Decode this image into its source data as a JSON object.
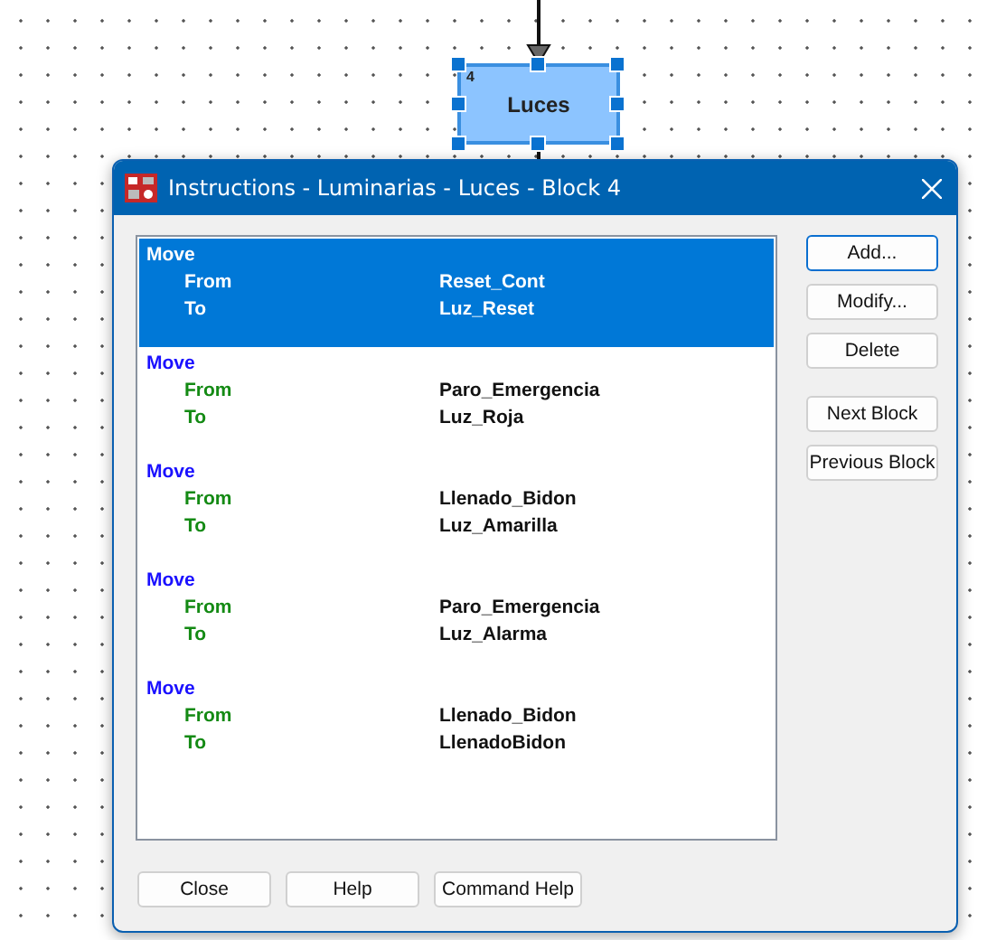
{
  "block": {
    "label": "Luces",
    "number": "4",
    "selected": true
  },
  "dialog": {
    "title": "Instructions - Luminarias - Luces - Block 4",
    "instructions": [
      {
        "command": "Move",
        "selected": true,
        "params": [
          {
            "name": "From",
            "value": "Reset_Cont"
          },
          {
            "name": "To",
            "value": "Luz_Reset"
          }
        ]
      },
      {
        "command": "Move",
        "selected": false,
        "params": [
          {
            "name": "From",
            "value": "Paro_Emergencia"
          },
          {
            "name": "To",
            "value": "Luz_Roja"
          }
        ]
      },
      {
        "command": "Move",
        "selected": false,
        "params": [
          {
            "name": "From",
            "value": "Llenado_Bidon"
          },
          {
            "name": "To",
            "value": "Luz_Amarilla"
          }
        ]
      },
      {
        "command": "Move",
        "selected": false,
        "params": [
          {
            "name": "From",
            "value": "Paro_Emergencia"
          },
          {
            "name": "To",
            "value": "Luz_Alarma"
          }
        ]
      },
      {
        "command": "Move",
        "selected": false,
        "params": [
          {
            "name": "From",
            "value": "Llenado_Bidon"
          },
          {
            "name": "To",
            "value": "LlenadoBidon"
          }
        ]
      }
    ],
    "side_buttons": [
      {
        "label": "Add...",
        "focused": true
      },
      {
        "label": "Modify...",
        "focused": false
      },
      {
        "label": "Delete",
        "focused": false
      },
      {
        "label": "Next Block",
        "focused": false
      },
      {
        "label": "Previous Block",
        "focused": false
      }
    ],
    "bottom_buttons": [
      {
        "label": "Close"
      },
      {
        "label": "Help"
      },
      {
        "label": "Command Help"
      }
    ]
  }
}
